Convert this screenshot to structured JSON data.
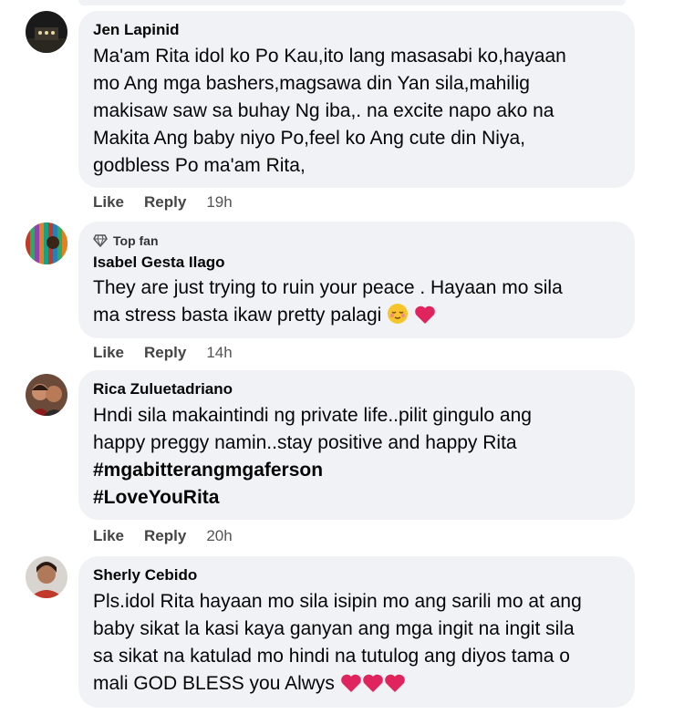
{
  "comments": [
    {
      "author": "Jen Lapinid",
      "badge": "",
      "lines": [
        "Ma'am Rita idol ko Po Kau,ito lang masasabi ko,hayaan",
        "mo Ang mga bashers,magsawa din Yan sila,mahilig",
        "makisaw saw sa buhay Ng iba,. na excite napo ako na",
        "Makita Ang baby niyo Po,feel ko Ang cute din Niya,",
        "godbless Po ma'am Rita,"
      ],
      "like": "Like",
      "reply": "Reply",
      "time": "19h"
    },
    {
      "author": "Isabel Gesta Ilago",
      "badge": "Top fan",
      "lines": [
        "They are just trying to ruin your peace . Hayaan mo sila",
        "ma stress basta ikaw pretty palagi"
      ],
      "like": "Like",
      "reply": "Reply",
      "time": "14h"
    },
    {
      "author": "Rica Zuluetadriano",
      "badge": "",
      "lines": [
        "Hndi sila makaintindi ng private life..pilit gingulo ang",
        "happy preggy namin..stay positive and happy Rita"
      ],
      "hashtags": [
        "#mgabitterangmgaferson",
        "#LoveYouRita"
      ],
      "like": "Like",
      "reply": "Reply",
      "time": "20h"
    },
    {
      "author": "Sherly Cebido",
      "badge": "",
      "lines": [
        "Pls.idol Rita hayaan mo sila isipin mo ang sarili mo at ang",
        "baby sikat la kasi kaya ganyan ang mga ingit na ingit sila",
        "sa sikat na katulad mo hindi na tutulog ang diyos tama o",
        "mali GOD BLESS you Alwys"
      ]
    }
  ],
  "colors": {
    "bubble": "#f0f2f5",
    "heart": "#e0245e"
  }
}
